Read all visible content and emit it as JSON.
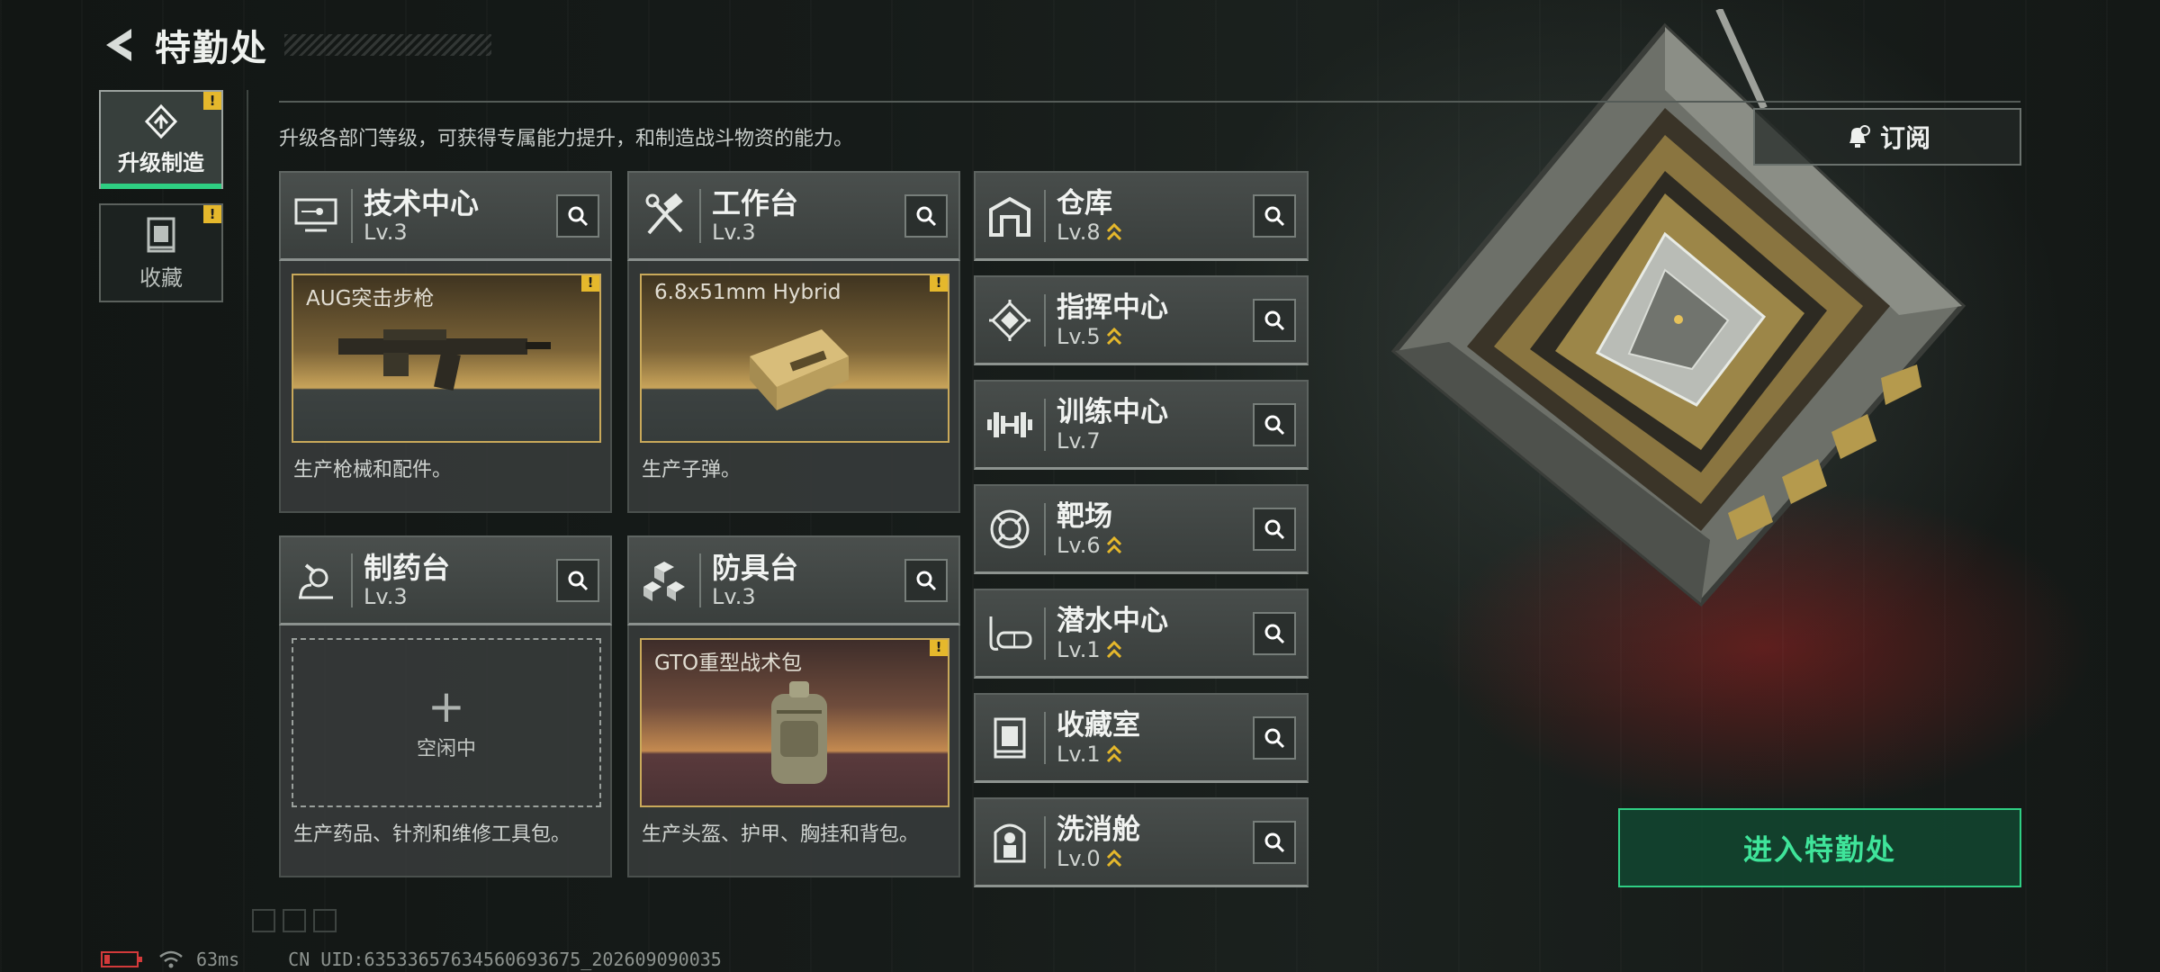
{
  "header": {
    "title": "特勤处"
  },
  "rail": {
    "tabs": [
      {
        "label": "升级制造",
        "alert": "!"
      },
      {
        "label": "收藏",
        "alert": "!"
      }
    ]
  },
  "intro": "升级各部门等级，可获得专属能力提升，和制造战斗物资的能力。",
  "panels": [
    {
      "name": "技术中心",
      "level": "Lv.3",
      "card_title": "AUG突击步枪",
      "alert": "!",
      "desc": "生产枪械和配件。"
    },
    {
      "name": "工作台",
      "level": "Lv.3",
      "card_title": "6.8x51mm Hybrid",
      "alert": "!",
      "desc": "生产子弹。"
    },
    {
      "name": "制药台",
      "level": "Lv.3",
      "idle_label": "空闲中",
      "idle_plus": "+",
      "desc": "生产药品、针剂和维修工具包。"
    },
    {
      "name": "防具台",
      "level": "Lv.3",
      "card_title": "GTO重型战术包",
      "alert": "!",
      "desc": "生产头盔、护甲、胸挂和背包。"
    }
  ],
  "facilities": [
    {
      "name": "仓库",
      "level": "Lv.8",
      "upgrade": true,
      "icon": "warehouse-icon"
    },
    {
      "name": "指挥中心",
      "level": "Lv.5",
      "upgrade": true,
      "icon": "command-chip-icon"
    },
    {
      "name": "训练中心",
      "level": "Lv.7",
      "upgrade": false,
      "icon": "dumbbell-icon"
    },
    {
      "name": "靶场",
      "level": "Lv.6",
      "upgrade": true,
      "icon": "target-icon"
    },
    {
      "name": "潜水中心",
      "level": "Lv.1",
      "upgrade": true,
      "icon": "dive-mask-icon"
    },
    {
      "name": "收藏室",
      "level": "Lv.1",
      "upgrade": true,
      "icon": "collection-case-icon"
    },
    {
      "name": "洗消舱",
      "level": "Lv.0",
      "upgrade": true,
      "icon": "decon-pod-icon"
    }
  ],
  "subscribe_label": "订阅",
  "enter_label": "进入特勤处",
  "footer": {
    "ping": "63ms",
    "uid": "CN UID:63533657634560693675_202609090035"
  },
  "colors": {
    "accent": "#2ecf82",
    "gold": "#e5b82c",
    "battery_low": "#d23a3a"
  }
}
